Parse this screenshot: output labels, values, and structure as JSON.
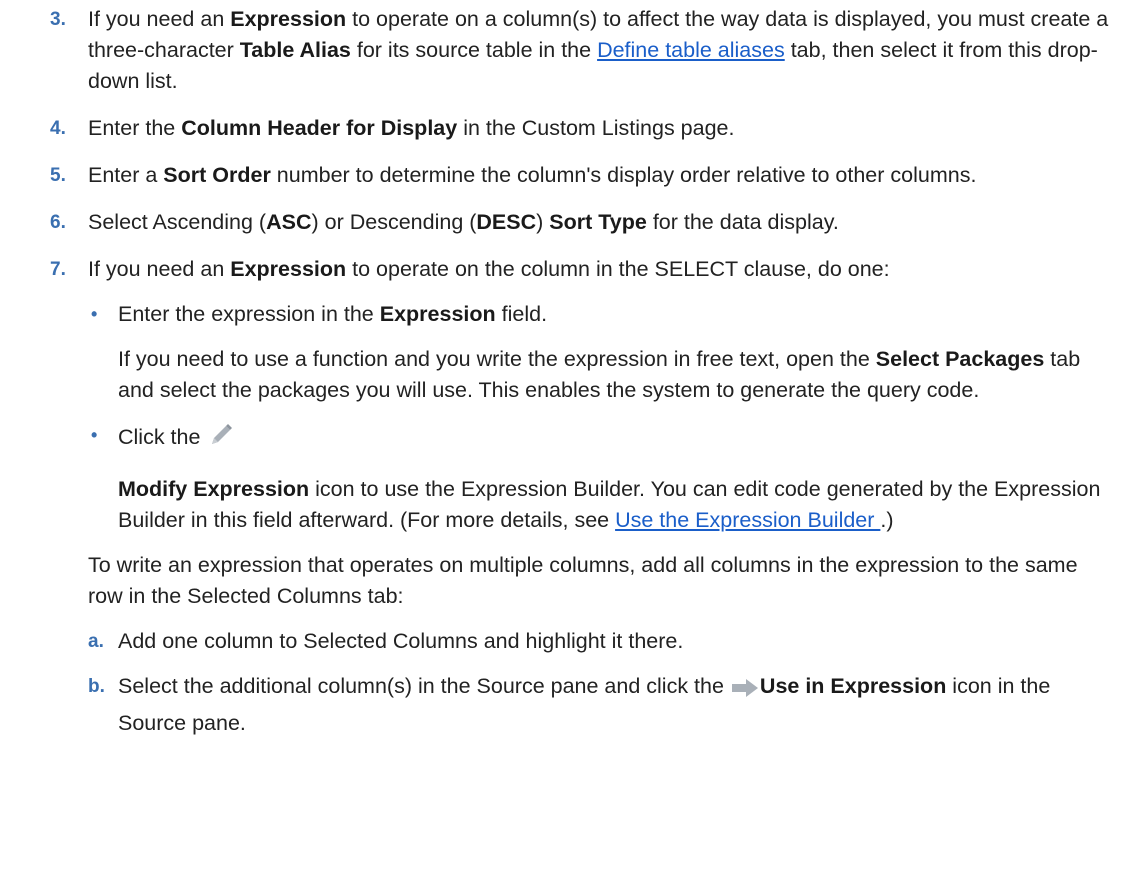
{
  "steps": {
    "s3": {
      "num": "3.",
      "t1": "If you need an ",
      "b1": "Expression",
      "t2": " to operate on a column(s) to affect the way data is displayed, you must create a three-character ",
      "b2": "Table Alias",
      "t3": " for its source table in the ",
      "link": "Define table aliases",
      "t4": " tab, then select it from this drop-down list."
    },
    "s4": {
      "num": "4.",
      "t1": "Enter the ",
      "b1": "Column Header for Display",
      "t2": " in the Custom Listings page."
    },
    "s5": {
      "num": "5.",
      "t1": "Enter a ",
      "b1": "Sort Order",
      "t2": " number to determine the column's display order relative to other columns."
    },
    "s6": {
      "num": "6.",
      "t1": "Select Ascending (",
      "b1": "ASC",
      "t2": ") or Descending (",
      "b2": "DESC",
      "t3": ") ",
      "b3": "Sort Type",
      "t4": " for the data display."
    },
    "s7": {
      "num": "7.",
      "t1": "If you need an ",
      "b1": "Expression",
      "t2": " to operate on the column in the SELECT clause, do one:",
      "bullet_char": "•",
      "bullet1": {
        "t1": "Enter the expression in the ",
        "b1": "Expression",
        "t2": " field.",
        "p2_t1": "If you need to use a function and you write the expression in free text, open the ",
        "p2_b1": "Select Packages",
        "p2_t2": " tab and select the packages you will use. This enables the system to generate the query code."
      },
      "bullet2": {
        "t1": "Click the ",
        "icon": "pencil-edit-icon",
        "b1": "Modify Expression",
        "t2": " icon to use the Expression Builder. You can edit code generated by the Expression Builder in this field afterward. (For more details, see ",
        "link": "Use the Expression Builder ",
        "t3": ".)"
      },
      "p_multi": "To write an expression that operates on multiple columns, add all columns in the expression to the same row in the Selected Columns tab:",
      "sub_a": {
        "letter": "a.",
        "text": "Add one column to Selected Columns and highlight it there."
      },
      "sub_b": {
        "letter": "b.",
        "t1": "Select the additional column(s) in the Source pane and click the ",
        "icon": "arrow-right-icon",
        "b1": "Use in Expression",
        "t2": " icon in the Source pane."
      }
    }
  },
  "colors": {
    "accent": "#3a6fb0",
    "link": "#1a5ec9"
  }
}
